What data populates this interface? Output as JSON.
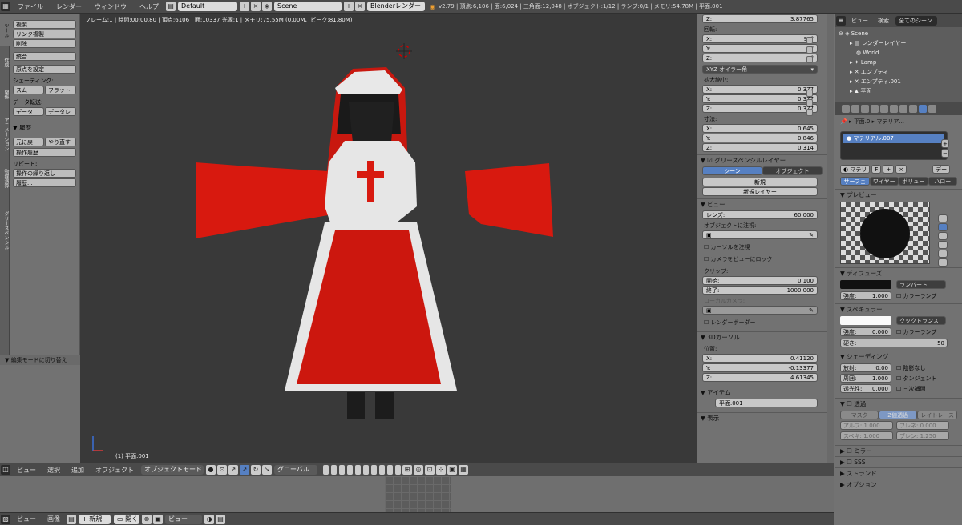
{
  "topbar": {
    "menus": [
      "ファイル",
      "レンダー",
      "ウィンドウ",
      "ヘルプ"
    ],
    "layout": "Default",
    "scene": "Scene",
    "engine": "Blenderレンダー",
    "stats": "v2.79 | 頂点:6,106 | 面:6,024 | 三角面:12,048 | オブジェクト:1/12 | ランプ:0/1 | メモリ:54.78M | 平面.001"
  },
  "tabs": [
    "ツール",
    "作成",
    "関係",
    "アニメーション",
    "物理演算",
    "グリースペンシル"
  ],
  "shelf": {
    "buttons1": [
      "複製",
      "リンク複製",
      "削除"
    ],
    "join": "統合",
    "origin": "原点を設定",
    "shading_label": "シェーディング:",
    "shading_btns": [
      "スムー",
      "フラット"
    ],
    "data_label": "データ転送:",
    "data_btns": [
      "データ",
      "データレ"
    ],
    "history_head": "履歴",
    "undo_btns": [
      "元に戻",
      "やり直す"
    ],
    "undo_history": "操作履歴",
    "repeat_label": "リピート:",
    "repeat": "操作の繰り返し",
    "history": "履歴..."
  },
  "operator": "編集モードに切り替え",
  "viewport": {
    "info": "フレーム:1 | 時間:00:00.80 | 頂点:6106 | 面:10337 光源:1 | メモリ:75.55M (0.00M、ピーク:81.80M)",
    "object": "(1) 平面.001"
  },
  "header3d": {
    "menus": [
      "ビュー",
      "選択",
      "追加",
      "オブジェクト"
    ],
    "mode": "オブジェクトモード",
    "orientation": "グローバル"
  },
  "bottombar": {
    "menus": [
      "ビュー",
      "画像"
    ],
    "new": "新規",
    "open": "開く",
    "view": "ビュー"
  },
  "npanel": {
    "z_top": {
      "label": "Z:",
      "value": "3.87765"
    },
    "rotation_label": "回転:",
    "rotation": [
      {
        "label": "X:",
        "value": "90°"
      },
      {
        "label": "Y:",
        "value": "0°"
      },
      {
        "label": "Z:",
        "value": "0°"
      }
    ],
    "rot_mode": "XYZ オイラー角",
    "scale_label": "拡大縮小:",
    "scale": [
      {
        "label": "X:",
        "value": "0.377"
      },
      {
        "label": "Y:",
        "value": "0.377"
      },
      {
        "label": "Z:",
        "value": "0.377"
      }
    ],
    "dims_label": "寸法:",
    "dims": [
      {
        "label": "X:",
        "value": "0.645"
      },
      {
        "label": "Y:",
        "value": "0.846"
      },
      {
        "label": "Z:",
        "value": "0.314"
      }
    ],
    "gp_head": "グリースペンシルレイヤー",
    "gp_tabs": [
      "シーン",
      "オブジェクト"
    ],
    "gp_new": "新規",
    "gp_new_layer": "新規レイヤー",
    "view_head": "ビュー",
    "lens": {
      "label": "レンズ:",
      "value": "60.000"
    },
    "lock_obj": "オブジェクトに注視:",
    "lock_cursor": "カーソルを注視",
    "lock_camera": "カメラをビューにロック",
    "clip_label": "クリップ:",
    "clip_start": {
      "label": "開始:",
      "value": "0.100"
    },
    "clip_end": {
      "label": "終了:",
      "value": "1000.000"
    },
    "local_cam": "ローカルカメラ:",
    "render_border": "レンダーボーダー",
    "cursor_head": "3Dカーソル",
    "location_label": "位置:",
    "location": [
      {
        "label": "X:",
        "value": "0.41120"
      },
      {
        "label": "Y:",
        "value": "-0.13377"
      },
      {
        "label": "Z:",
        "value": "4.61345"
      }
    ],
    "item_head": "アイテム",
    "item_name": "平面.001",
    "display_head": "表示"
  },
  "outliner": {
    "view": "ビュー",
    "search": "検索",
    "filter": "全てのシーン",
    "rows": [
      "Scene",
      "レンダーレイヤー",
      "World",
      "Lamp",
      "エンプティ",
      "エンプティ.001",
      "平面"
    ]
  },
  "props": {
    "breadcrumb_obj": "平面.0",
    "breadcrumb_mat": "マテリア...",
    "slot": "マテリアル.007",
    "mat_field": "マテリ",
    "mat_f": "F",
    "data_btn": "デー",
    "type_tabs": [
      "サーフェ",
      "ワイヤー",
      "ボリュー",
      "ハロー"
    ],
    "preview_head": "プレビュー",
    "diffuse_head": "ディフューズ",
    "diffuse_shader": "ランバート",
    "diffuse_intensity": {
      "label": "強度:",
      "value": "1.000"
    },
    "color_ramp": "カラーランプ",
    "specular_head": "スペキュラー",
    "spec_shader": "クックトランス",
    "spec_intensity": {
      "label": "強度:",
      "value": "0.000"
    },
    "hardness": {
      "label": "硬さ:",
      "value": "50"
    },
    "shading_head": "シェーディング",
    "emit": {
      "label": "放射:",
      "value": "0.00"
    },
    "ambient": {
      "label": "周囲:",
      "value": "1.000"
    },
    "translucency": {
      "label": "透光性:",
      "value": "0.000"
    },
    "shadeless": "陰影なし",
    "tangent": "タンジェント",
    "cubic": "三次補間",
    "transp_head": "透過",
    "transp_tabs": [
      "マスク",
      "Z値透過",
      "レイトレース"
    ],
    "alpha": "アルフ: 1.000",
    "fresnel": "フレネ: 0.000",
    "spec_t": "スペキ: 1.000",
    "blend": "ブレン: 1.250",
    "mirror_head": "ミラー",
    "sss_head": "SSS",
    "strand_head": "ストランド",
    "options_head": "オプション"
  }
}
